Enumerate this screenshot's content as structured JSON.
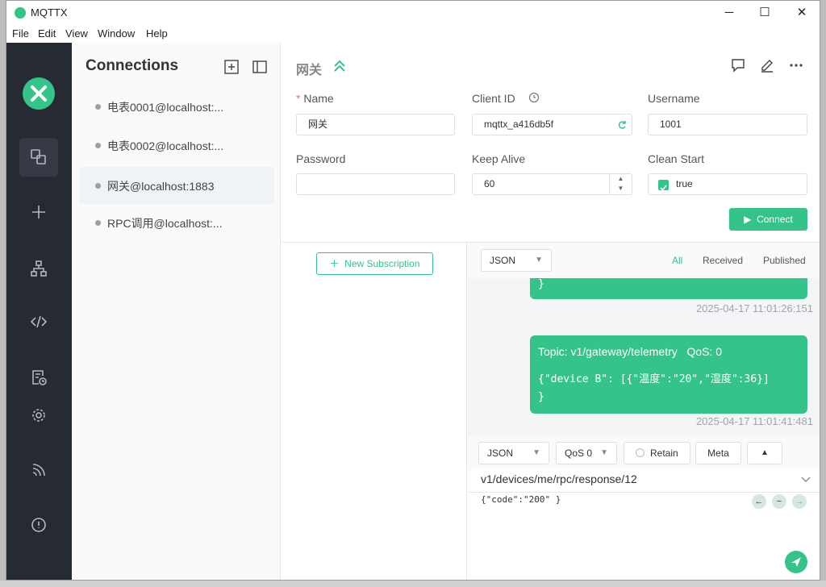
{
  "window": {
    "title": "MQTTX",
    "minimize": "─",
    "maximize": "☐",
    "close": "✕"
  },
  "menu": [
    "File",
    "Edit",
    "View",
    "Window",
    "Help"
  ],
  "sidebar": {
    "title": "Connections",
    "items": [
      {
        "label": "电表0001@localhost:..."
      },
      {
        "label": "电表0002@localhost:..."
      },
      {
        "label": "网关@localhost:1883"
      },
      {
        "label": "RPC调用@localhost:..."
      }
    ]
  },
  "connection": {
    "name": "网关",
    "fields": {
      "name_label": "Name",
      "name_value": "网关",
      "clientid_label": "Client ID",
      "clientid_value": "mqttx_a416db5f",
      "username_label": "Username",
      "username_value": "1001",
      "password_label": "Password",
      "password_value": "",
      "keepalive_label": "Keep Alive",
      "keepalive_value": "60",
      "cleanstart_label": "Clean Start",
      "cleanstart_value": "true"
    },
    "required_mark": "*",
    "connect_label": "Connect"
  },
  "subscriptions": {
    "new_label": "New Subscription"
  },
  "messages": {
    "format": "JSON",
    "filters": {
      "all": "All",
      "received": "Received",
      "published": "Published"
    },
    "items": [
      {
        "topic": "",
        "qos": "",
        "body": "}",
        "time": "2025-04-17 11:01:26:151"
      },
      {
        "topic": "Topic: v1/gateway/telemetry",
        "qos": "QoS: 0",
        "body": "{\"device B\": [{\"温度\":\"20\",\"湿度\":36}]\n}",
        "time": "2025-04-17 11:01:41:481"
      }
    ]
  },
  "publish": {
    "format": "JSON",
    "qos": "QoS 0",
    "retain": "Retain",
    "meta": "Meta",
    "topic": "v1/devices/me/rpc/response/12",
    "payload": "{\"code\":\"200\" }"
  },
  "colors": {
    "accent": "#34c388",
    "rail": "#262a32"
  }
}
